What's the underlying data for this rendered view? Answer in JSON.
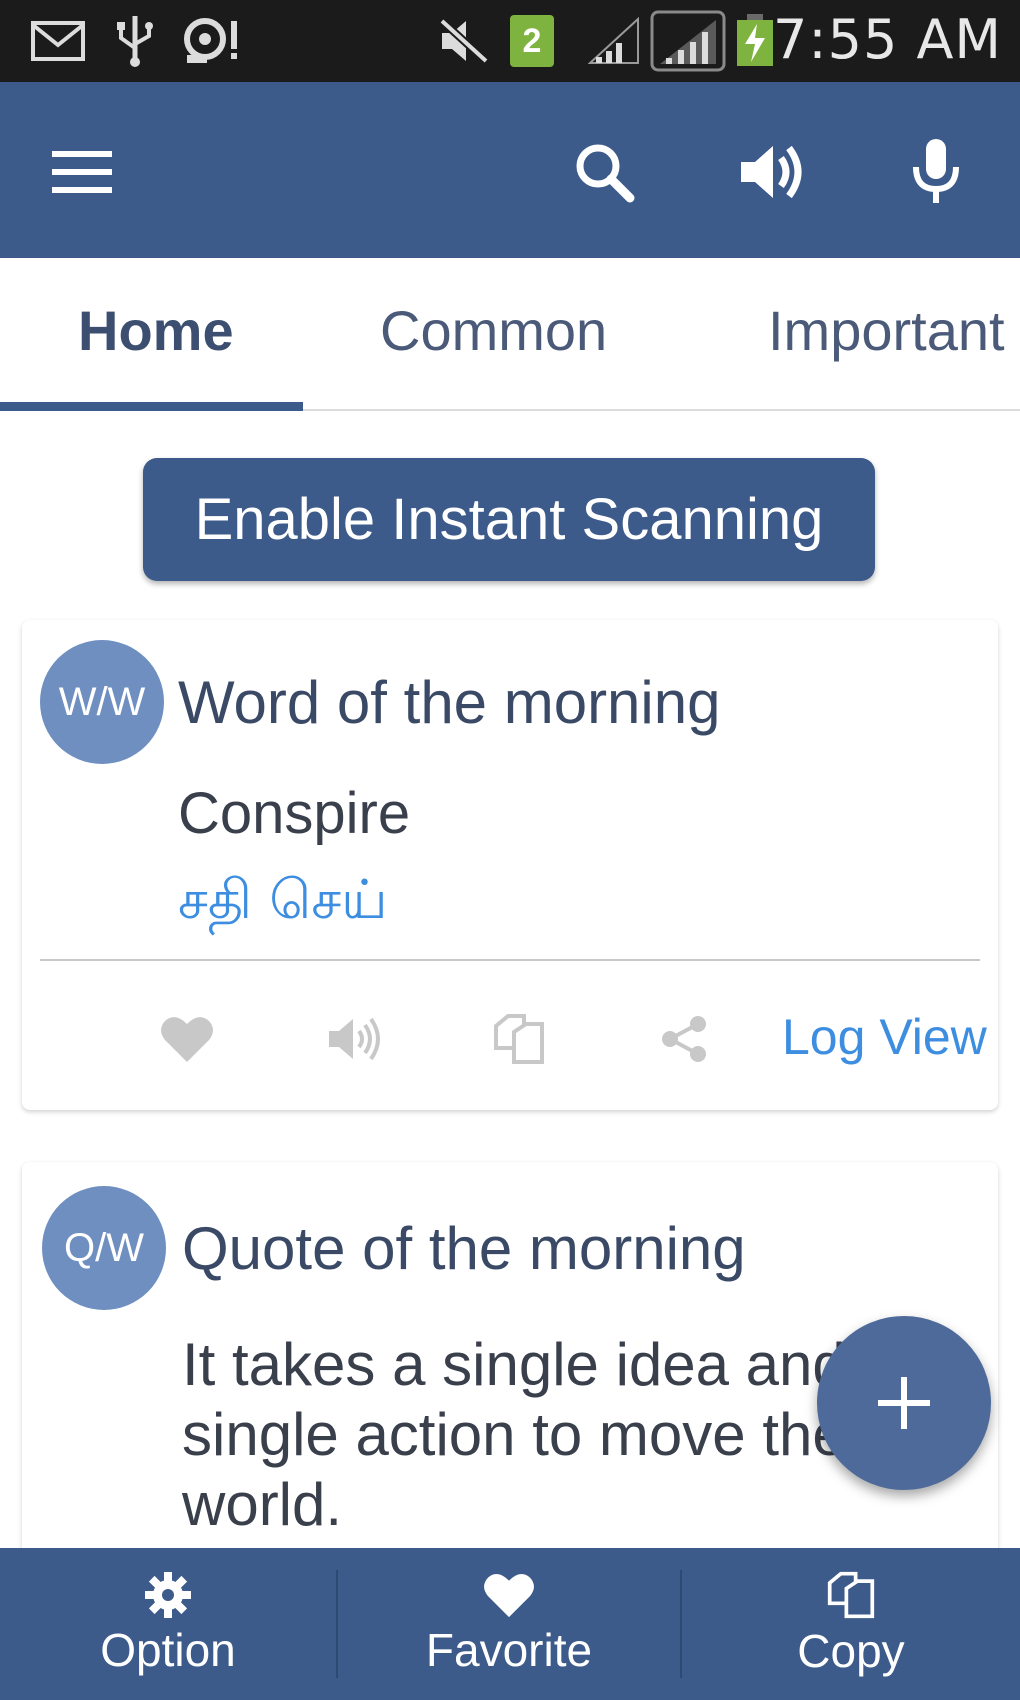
{
  "status_bar": {
    "time": "7:55 AM",
    "sim_slot": "2",
    "icons": [
      "mail-icon",
      "usb-icon",
      "voicemail-icon",
      "mute-icon",
      "sim-icon",
      "signal-icon",
      "signal-icon",
      "battery-charging-icon"
    ]
  },
  "app_bar": {
    "icons": [
      "menu-icon",
      "search-icon",
      "speaker-icon",
      "microphone-icon"
    ]
  },
  "tabs": [
    {
      "label": "Home",
      "active": true
    },
    {
      "label": "Common",
      "active": false
    },
    {
      "label": "Important",
      "active": false
    }
  ],
  "enable_button": {
    "label": "Enable Instant Scanning"
  },
  "word_card": {
    "avatar": "W/W",
    "title": "Word of the morning",
    "word": "Conspire",
    "translation": "சதி செய்",
    "log_view": "Log View",
    "actions": [
      "heart-icon",
      "speaker-icon",
      "copy-icon",
      "share-icon"
    ]
  },
  "quote_card": {
    "avatar": "Q/W",
    "title": "Quote of the morning",
    "quote": "It takes a single idea and a single action to move the world."
  },
  "fab": {
    "icon": "plus-icon"
  },
  "bottom_bar": {
    "items": [
      {
        "label": "Option",
        "icon": "gear-icon"
      },
      {
        "label": "Favorite",
        "icon": "heart-icon"
      },
      {
        "label": "Copy",
        "icon": "copy-icon"
      }
    ]
  },
  "colors": {
    "primary": "#3c5a8a",
    "avatar": "#6f8fc1",
    "link": "#3d8ee0",
    "action_gray": "#c8c8c8"
  }
}
